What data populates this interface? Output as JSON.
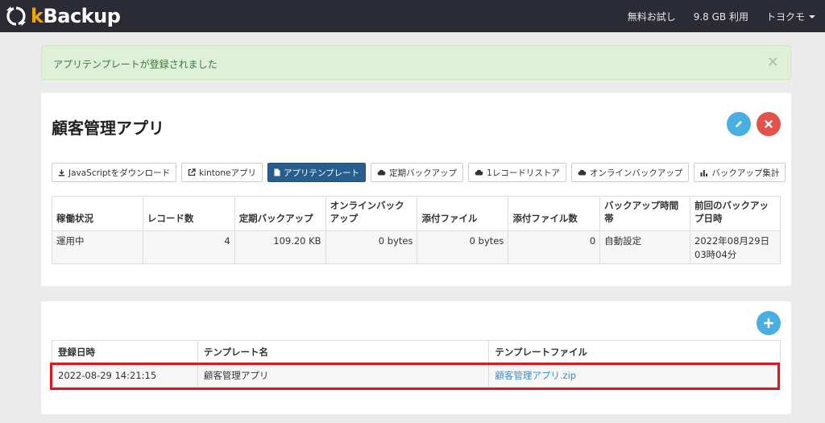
{
  "nav": {
    "brand": "Backup",
    "brand_k": "k",
    "trial": "無料お試し",
    "usage": "9.8 GB 利用",
    "user": "トヨクモ"
  },
  "alert": {
    "message": "アプリテンプレートが登録されました",
    "close": "×"
  },
  "app": {
    "title": "顧客管理アプリ"
  },
  "toolbar": {
    "js_download": "JavaScriptをダウンロード",
    "kintone_app": "kintoneアプリ",
    "app_template": "アプリテンプレート",
    "scheduled_backup": "定期バックアップ",
    "one_record_restore": "1レコードリストア",
    "online_backup": "オンラインバックアップ",
    "backup_stats": "バックアップ集計"
  },
  "stats": {
    "headers": [
      "稼働状況",
      "レコード数",
      "定期バックアップ",
      "オンラインバックアップ",
      "添付ファイル",
      "添付ファイル数",
      "バックアップ時間帯",
      "前回のバックアップ日時"
    ],
    "row": [
      "運用中",
      "4",
      "109.20 KB",
      "0 bytes",
      "0 bytes",
      "0",
      "自動設定",
      "2022年08月29日03時04分"
    ]
  },
  "templates": {
    "headers": [
      "登録日時",
      "テンプレート名",
      "テンプレートファイル"
    ],
    "rows": [
      {
        "date": "2022-08-29 14:21:15",
        "name": "顧客管理アプリ",
        "file": "顧客管理アプリ.zip"
      }
    ]
  },
  "colors": {
    "navbar": "#2b2b36",
    "alert_bg": "#dff0d8",
    "active_button": "#285e8e",
    "edit_button": "#4aaee0",
    "delete_button": "#e0524b",
    "highlight": "#e0151f",
    "link": "#3a8bd0"
  }
}
